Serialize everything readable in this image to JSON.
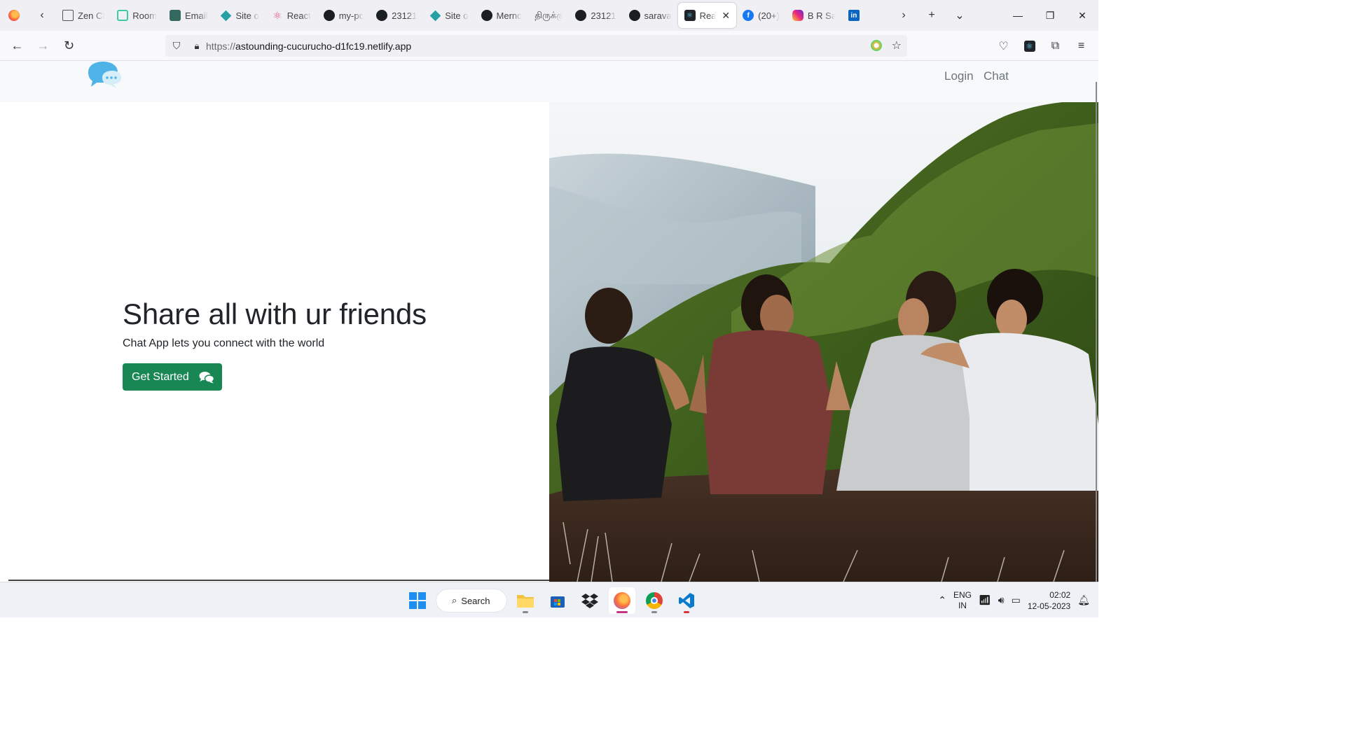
{
  "browser": {
    "tabs": [
      {
        "label": "Zen Cl",
        "icon": "zen-icon",
        "kind": "zen"
      },
      {
        "label": "Room",
        "icon": "room-icon",
        "kind": "room"
      },
      {
        "label": "Email",
        "icon": "email-icon",
        "kind": "email"
      },
      {
        "label": "Site o",
        "icon": "netlify-diamond-icon",
        "kind": "diamond"
      },
      {
        "label": "React",
        "icon": "react-icon",
        "kind": "react"
      },
      {
        "label": "my-pc",
        "icon": "github-icon",
        "kind": "gh"
      },
      {
        "label": "23121",
        "icon": "github-icon",
        "kind": "gh"
      },
      {
        "label": "Site o",
        "icon": "netlify-diamond-icon",
        "kind": "diamond"
      },
      {
        "label": "Merno",
        "icon": "github-icon",
        "kind": "gh"
      },
      {
        "label": "திருக்குற",
        "icon": "",
        "kind": "none"
      },
      {
        "label": "23121",
        "icon": "github-icon",
        "kind": "gh"
      },
      {
        "label": "sarava",
        "icon": "github-icon",
        "kind": "gh"
      },
      {
        "label": "Rea",
        "icon": "react-icon",
        "kind": "reactactive",
        "active": true
      },
      {
        "label": "(20+)",
        "icon": "facebook-icon",
        "kind": "fb"
      },
      {
        "label": "B R Sa",
        "icon": "instagram-icon",
        "kind": "ig"
      },
      {
        "label": "",
        "icon": "linkedin-icon",
        "kind": "li"
      }
    ],
    "url_protocol": "https://",
    "url_host": "astounding-cucurucho-d1fc19.netlify.app"
  },
  "site": {
    "nav": {
      "login": "Login",
      "chat": "Chat"
    },
    "hero": {
      "title": "Share all with ur friends",
      "subtitle": "Chat App lets you connect with the world",
      "cta": "Get Started"
    }
  },
  "taskbar": {
    "search_label": "Search",
    "lang_line1": "ENG",
    "lang_line2": "IN",
    "time": "02:02",
    "date": "12-05-2023"
  },
  "colors": {
    "cta": "#198754",
    "nav_link": "#6c757d",
    "logo": "#4fb3e8"
  }
}
